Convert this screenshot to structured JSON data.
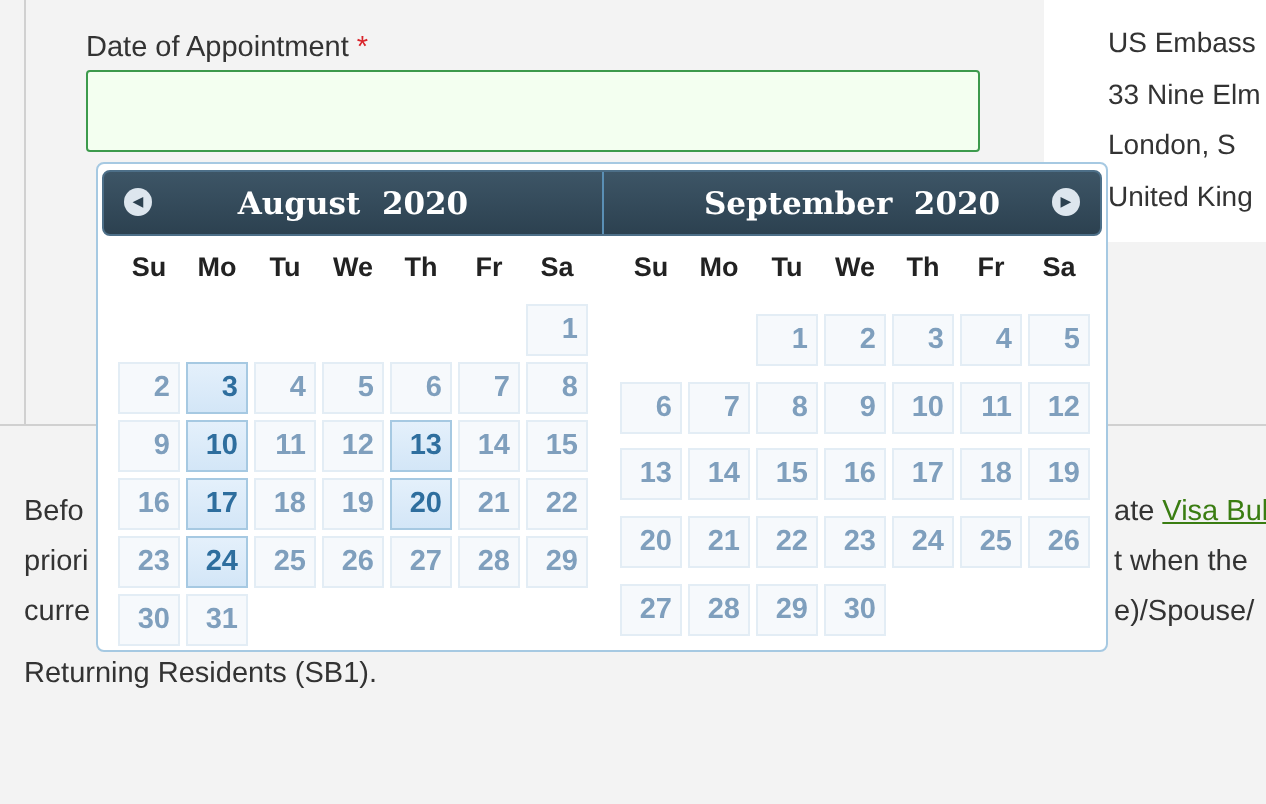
{
  "field": {
    "label": "Date of Appointment",
    "required_mark": "*",
    "valid": true
  },
  "address": [
    "US Embass",
    "33 Nine Elm",
    "London, S",
    "United King"
  ],
  "paragraph": [
    {
      "left": "Befo",
      "right": "ate",
      "link": "Visa Bul"
    },
    {
      "left": "priori",
      "right": "t when the"
    },
    {
      "left": "curre",
      "right": "e)/Spouse/"
    },
    {
      "left": "Returning Residents (SB1)."
    }
  ],
  "datepicker": {
    "prev": "◀",
    "next": "▶",
    "months": [
      {
        "title": "August  2020",
        "weekdays": [
          "Su",
          "Mo",
          "Tu",
          "We",
          "Th",
          "Fr",
          "Sa"
        ],
        "weeks": [
          [
            {
              "kind": "blank"
            },
            {
              "kind": "blank"
            },
            {
              "kind": "blank"
            },
            {
              "kind": "blank"
            },
            {
              "kind": "blank"
            },
            {
              "kind": "blank"
            },
            {
              "kind": "day",
              "day": "1",
              "available": false
            }
          ],
          [
            {
              "kind": "day",
              "day": "2",
              "available": false
            },
            {
              "kind": "day",
              "day": "3",
              "available": true
            },
            {
              "kind": "day",
              "day": "4",
              "available": false
            },
            {
              "kind": "day",
              "day": "5",
              "available": false
            },
            {
              "kind": "day",
              "day": "6",
              "available": false
            },
            {
              "kind": "day",
              "day": "7",
              "available": false
            },
            {
              "kind": "day",
              "day": "8",
              "available": false
            }
          ],
          [
            {
              "kind": "day",
              "day": "9",
              "available": false
            },
            {
              "kind": "day",
              "day": "10",
              "available": true
            },
            {
              "kind": "day",
              "day": "11",
              "available": false
            },
            {
              "kind": "day",
              "day": "12",
              "available": false
            },
            {
              "kind": "day",
              "day": "13",
              "available": true
            },
            {
              "kind": "day",
              "day": "14",
              "available": false
            },
            {
              "kind": "day",
              "day": "15",
              "available": false
            }
          ],
          [
            {
              "kind": "day",
              "day": "16",
              "available": false
            },
            {
              "kind": "day",
              "day": "17",
              "available": true
            },
            {
              "kind": "day",
              "day": "18",
              "available": false
            },
            {
              "kind": "day",
              "day": "19",
              "available": false
            },
            {
              "kind": "day",
              "day": "20",
              "available": true
            },
            {
              "kind": "day",
              "day": "21",
              "available": false
            },
            {
              "kind": "day",
              "day": "22",
              "available": false
            }
          ],
          [
            {
              "kind": "day",
              "day": "23",
              "available": false
            },
            {
              "kind": "day",
              "day": "24",
              "available": true
            },
            {
              "kind": "day",
              "day": "25",
              "available": false
            },
            {
              "kind": "day",
              "day": "26",
              "available": false
            },
            {
              "kind": "day",
              "day": "27",
              "available": false
            },
            {
              "kind": "day",
              "day": "28",
              "available": false
            },
            {
              "kind": "day",
              "day": "29",
              "available": false
            }
          ],
          [
            {
              "kind": "day",
              "day": "30",
              "available": false
            },
            {
              "kind": "day",
              "day": "31",
              "available": false
            }
          ]
        ]
      },
      {
        "title": "September  2020",
        "weekdays": [
          "Su",
          "Mo",
          "Tu",
          "We",
          "Th",
          "Fr",
          "Sa"
        ],
        "weeks": [
          [
            {
              "kind": "blank"
            },
            {
              "kind": "blank"
            },
            {
              "kind": "day",
              "day": "1",
              "available": false
            },
            {
              "kind": "day",
              "day": "2",
              "available": false
            },
            {
              "kind": "day",
              "day": "3",
              "available": false
            },
            {
              "kind": "day",
              "day": "4",
              "available": false
            },
            {
              "kind": "day",
              "day": "5",
              "available": false
            }
          ],
          [
            {
              "kind": "day",
              "day": "6",
              "available": false
            },
            {
              "kind": "day",
              "day": "7",
              "available": false
            },
            {
              "kind": "day",
              "day": "8",
              "available": false
            },
            {
              "kind": "day",
              "day": "9",
              "available": false
            },
            {
              "kind": "day",
              "day": "10",
              "available": false
            },
            {
              "kind": "day",
              "day": "11",
              "available": false
            },
            {
              "kind": "day",
              "day": "12",
              "available": false
            }
          ],
          [
            {
              "kind": "day",
              "day": "13",
              "available": false
            },
            {
              "kind": "day",
              "day": "14",
              "available": false
            },
            {
              "kind": "day",
              "day": "15",
              "available": false
            },
            {
              "kind": "day",
              "day": "16",
              "available": false
            },
            {
              "kind": "day",
              "day": "17",
              "available": false
            },
            {
              "kind": "day",
              "day": "18",
              "available": false
            },
            {
              "kind": "day",
              "day": "19",
              "available": false
            }
          ],
          [
            {
              "kind": "day",
              "day": "20",
              "available": false
            },
            {
              "kind": "day",
              "day": "21",
              "available": false
            },
            {
              "kind": "day",
              "day": "22",
              "available": false
            },
            {
              "kind": "day",
              "day": "23",
              "available": false
            },
            {
              "kind": "day",
              "day": "24",
              "available": false
            },
            {
              "kind": "day",
              "day": "25",
              "available": false
            },
            {
              "kind": "day",
              "day": "26",
              "available": false
            }
          ],
          [
            {
              "kind": "day",
              "day": "27",
              "available": false
            },
            {
              "kind": "day",
              "day": "28",
              "available": false
            },
            {
              "kind": "day",
              "day": "29",
              "available": false
            },
            {
              "kind": "day",
              "day": "30",
              "available": false
            }
          ]
        ]
      }
    ]
  }
}
